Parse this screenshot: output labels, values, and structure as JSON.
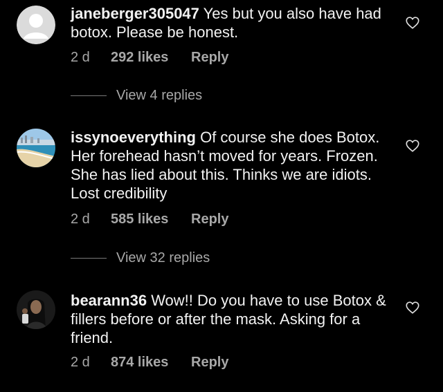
{
  "comments": [
    {
      "username": "janeberger305047",
      "text": "Yes but you also have had botox. Please be honest.",
      "time": "2 d",
      "likes": "292 likes",
      "reply": "Reply",
      "view_replies": "View 4 replies",
      "avatar": "default-avatar-icon"
    },
    {
      "username": "issynoeverything",
      "text": "Of course she does Botox. Her forehead hasn’t moved for years. Frozen.  She has lied about this.  Thinks we are idiots.  Lost credibility",
      "time": "2 d",
      "likes": "585 likes",
      "reply": "Reply",
      "view_replies": "View 32 replies",
      "avatar": "beach-photo-avatar"
    },
    {
      "username": "bearann36",
      "text": "Wow!! Do you have to use Botox & fillers before or after the mask. Asking for a friend.",
      "time": "2 d",
      "likes": "874 likes",
      "reply": "Reply",
      "avatar": "profile-photo-avatar"
    }
  ],
  "colors": {
    "background": "#000000",
    "text": "#f2f2f2",
    "muted": "#a8a8a8"
  }
}
